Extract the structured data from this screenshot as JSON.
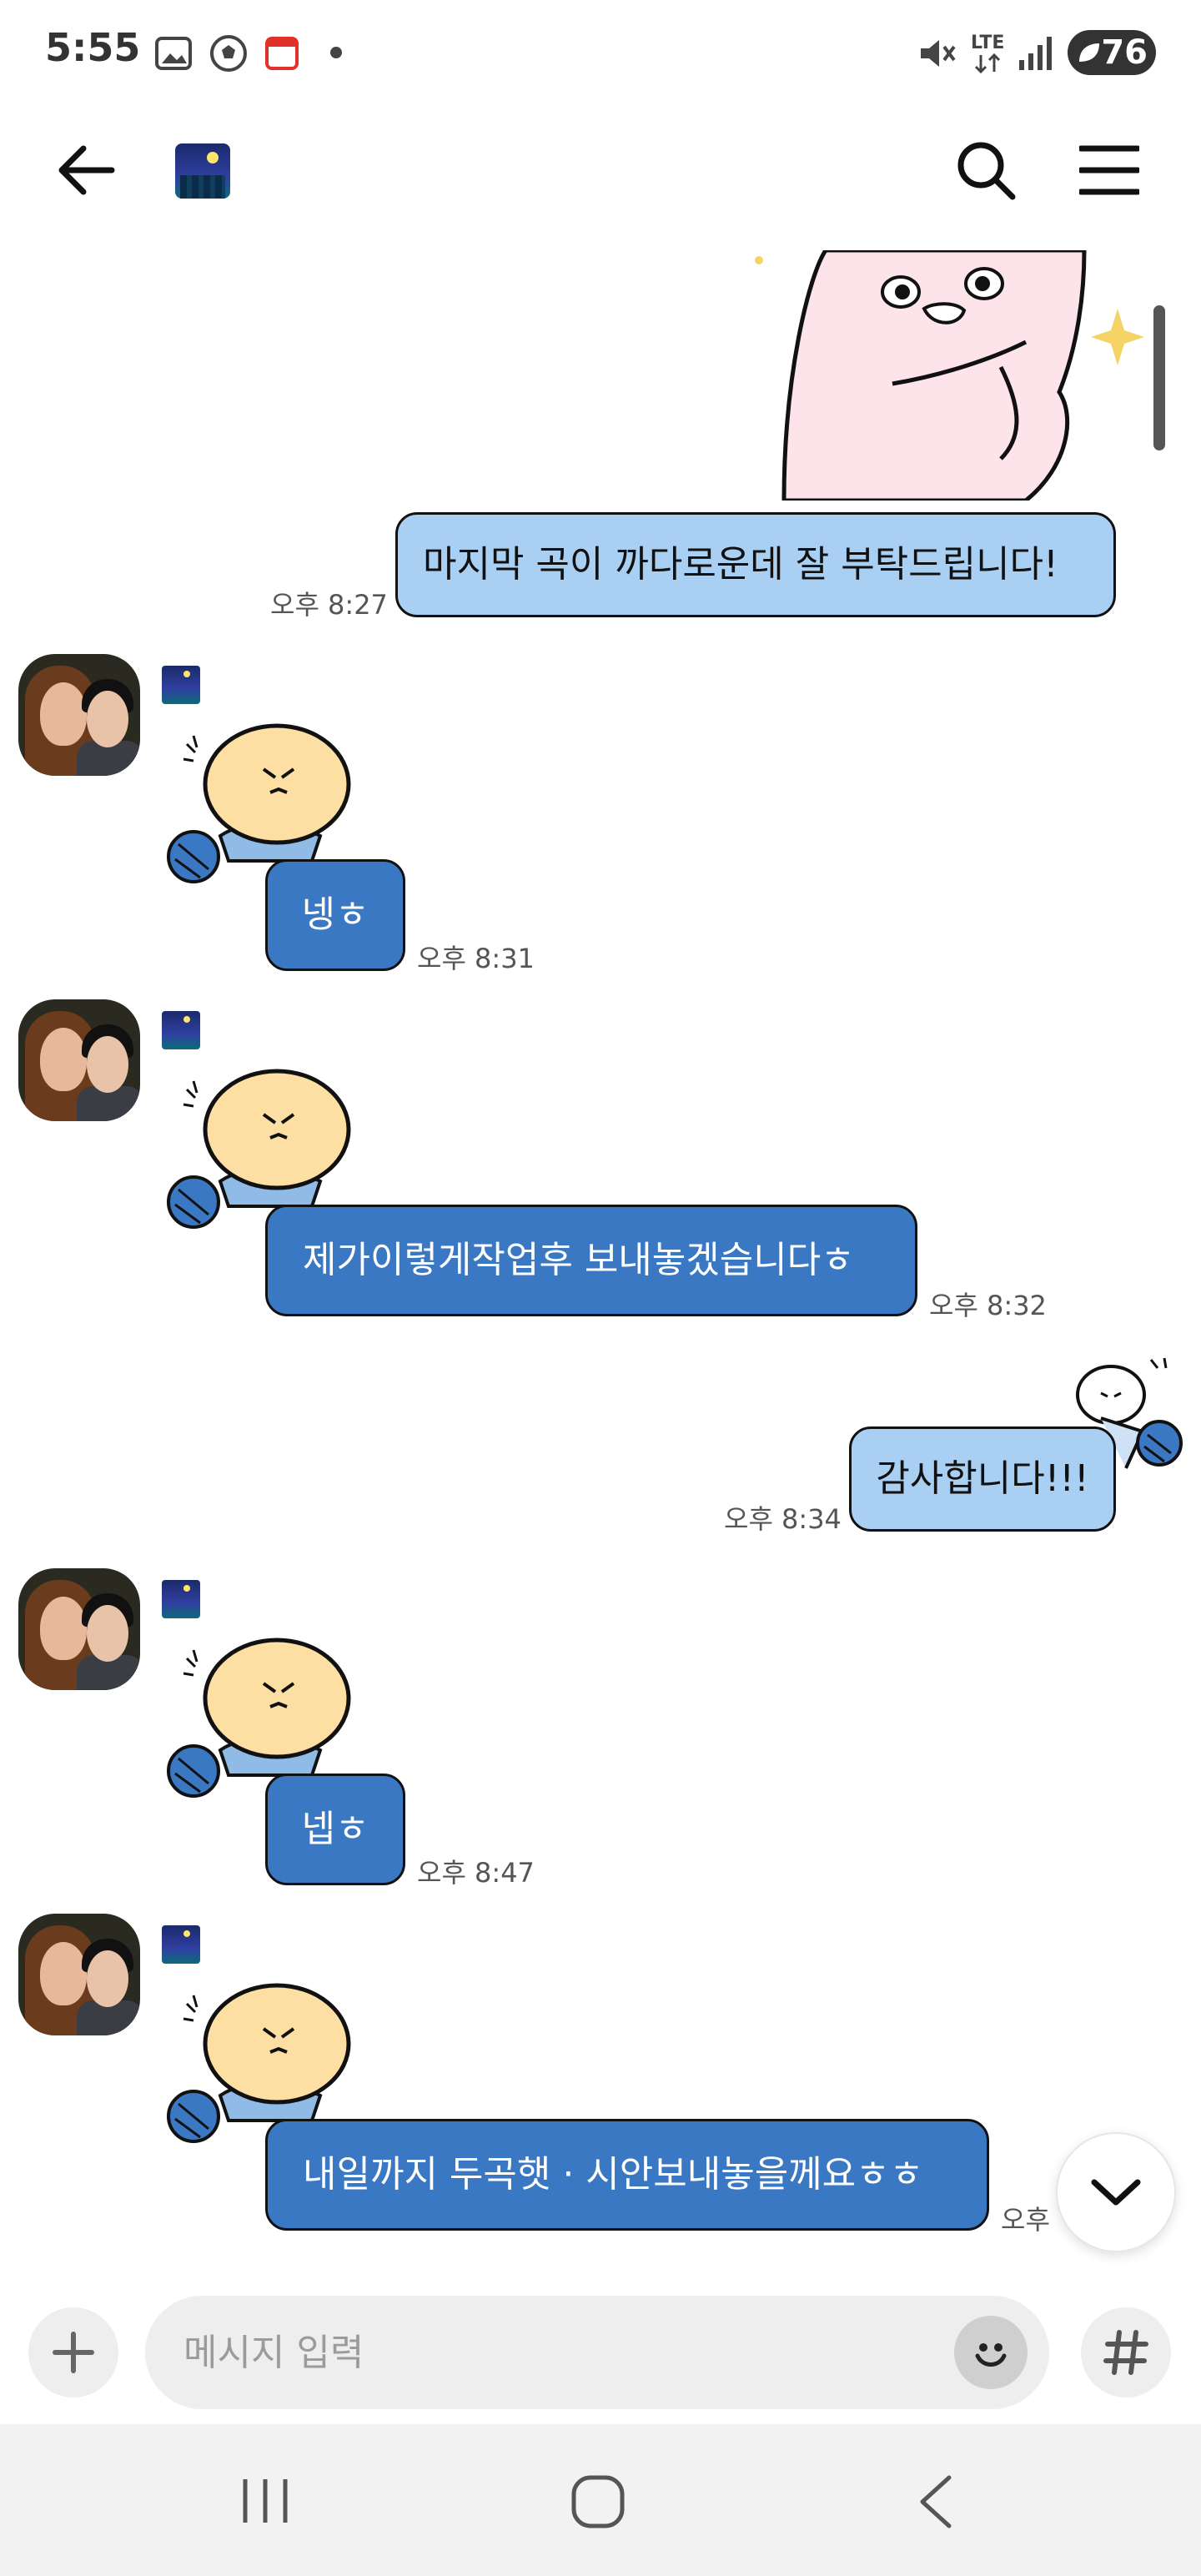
{
  "status_bar": {
    "time": "5:55",
    "battery": "76"
  },
  "messages": [
    {
      "direction": "out",
      "text": "마지막 곡이 까다로운데 잘 부탁드립니다!",
      "time": "오후 8:27"
    },
    {
      "direction": "in",
      "text": "넹ㅎ",
      "time": "오후 8:31"
    },
    {
      "direction": "in",
      "text": "제가이렇게작업후 보내놓겠습니다ㅎ",
      "time": "오후 8:32"
    },
    {
      "direction": "out",
      "text": "감사합니다!!!",
      "time": "오후 8:34"
    },
    {
      "direction": "in",
      "text": "넵ㅎ",
      "time": "오후 8:47"
    },
    {
      "direction": "in",
      "text": "내일까지 두곡햇 · 시안보내놓을께요ㅎㅎ",
      "time": "오후 "
    }
  ],
  "input": {
    "placeholder": "메시지 입력"
  },
  "colors": {
    "outgoing_bubble": "#a9cff3",
    "incoming_bubble": "#3a78c4"
  },
  "icons": {
    "back": "arrow-left-icon",
    "search": "search-icon",
    "menu": "hamburger-menu-icon",
    "plus": "plus-icon",
    "emoji": "smiley-icon",
    "hash": "hash-icon",
    "scroll_down": "chevron-down-icon"
  }
}
